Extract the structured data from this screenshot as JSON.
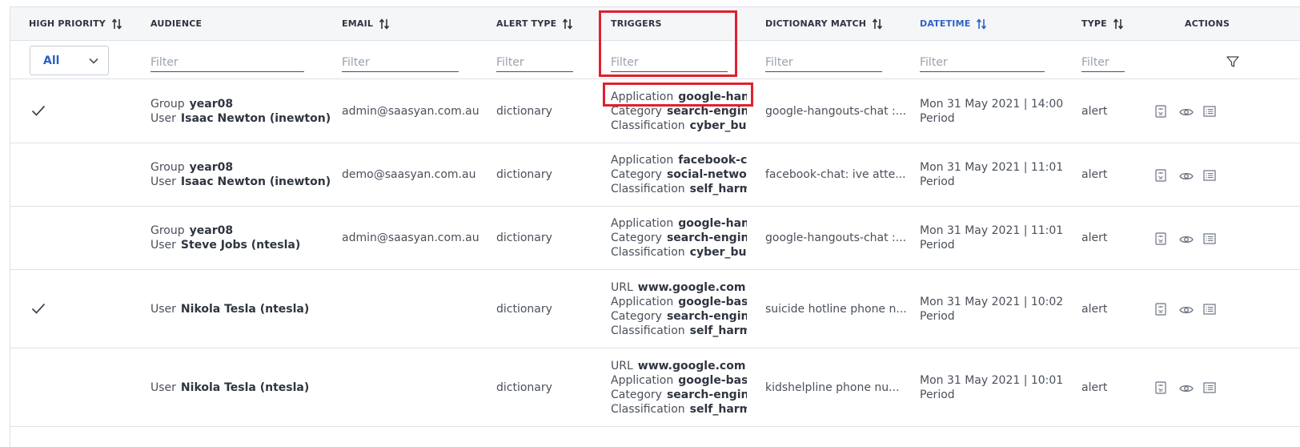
{
  "columns": {
    "high_priority": "HIGH PRIORITY",
    "audience": "AUDIENCE",
    "email": "EMAIL",
    "alert_type": "ALERT TYPE",
    "triggers": "TRIGGERS",
    "dictionary_match": "DICTIONARY MATCH",
    "datetime": "DATETIME",
    "type": "TYPE",
    "actions": "ACTIONS"
  },
  "filters": {
    "priority_select_value": "All",
    "placeholder": "Filter"
  },
  "colors": {
    "accent": "#2f64c8",
    "highlight": "#e0202e",
    "border": "#dde1e6"
  },
  "rows": [
    {
      "high_priority": true,
      "audience": [
        {
          "key": "Group",
          "value": "year08"
        },
        {
          "key": "User",
          "value": "Isaac Newton (inewton)"
        }
      ],
      "email": "admin@saasyan.com.au",
      "alert_type": "dictionary",
      "triggers": [
        {
          "key": "Application",
          "value": "google-hangouts-chat"
        },
        {
          "key": "Category",
          "value": "search-engines"
        },
        {
          "key": "Classification",
          "value": "cyber_bullying"
        }
      ],
      "dictionary_match": "google-hangouts-chat :...",
      "datetime": "Mon 31 May 2021 | 14:00",
      "period": "Period",
      "type": "alert"
    },
    {
      "high_priority": false,
      "audience": [
        {
          "key": "Group",
          "value": "year08"
        },
        {
          "key": "User",
          "value": "Isaac Newton (inewton)"
        }
      ],
      "email": "demo@saasyan.com.au",
      "alert_type": "dictionary",
      "triggers": [
        {
          "key": "Application",
          "value": "facebook-chat"
        },
        {
          "key": "Category",
          "value": "social-networking"
        },
        {
          "key": "Classification",
          "value": "self_harm"
        }
      ],
      "dictionary_match": "facebook-chat: ive atte...",
      "datetime": "Mon 31 May 2021 | 11:01",
      "period": "Period",
      "type": "alert"
    },
    {
      "high_priority": false,
      "audience": [
        {
          "key": "Group",
          "value": "year08"
        },
        {
          "key": "User",
          "value": "Steve Jobs (ntesla)"
        }
      ],
      "email": "admin@saasyan.com.au",
      "alert_type": "dictionary",
      "triggers": [
        {
          "key": "Application",
          "value": "google-hangouts-chat"
        },
        {
          "key": "Category",
          "value": "search-engines"
        },
        {
          "key": "Classification",
          "value": "cyber_bullying"
        }
      ],
      "dictionary_match": "google-hangouts-chat :...",
      "datetime": "Mon 31 May 2021 | 11:01",
      "period": "Period",
      "type": "alert"
    },
    {
      "high_priority": true,
      "audience": [
        {
          "key": "User",
          "value": "Nikola Tesla (ntesla)"
        }
      ],
      "email": "",
      "alert_type": "dictionary",
      "triggers": [
        {
          "key": "URL",
          "value": "www.google.com"
        },
        {
          "key": "Application",
          "value": "google-base"
        },
        {
          "key": "Category",
          "value": "search-engines"
        },
        {
          "key": "Classification",
          "value": "self_harm"
        }
      ],
      "dictionary_match": "suicide hotline phone n...",
      "datetime": "Mon 31 May 2021 | 10:02",
      "period": "Period",
      "type": "alert"
    },
    {
      "high_priority": false,
      "audience": [
        {
          "key": "User",
          "value": "Nikola Tesla (ntesla)"
        }
      ],
      "email": "",
      "alert_type": "dictionary",
      "triggers": [
        {
          "key": "URL",
          "value": "www.google.com"
        },
        {
          "key": "Application",
          "value": "google-base"
        },
        {
          "key": "Category",
          "value": "search-engines"
        },
        {
          "key": "Classification",
          "value": "self_harm"
        }
      ],
      "dictionary_match": "kidshelpline phone nu...",
      "datetime": "Mon 31 May 2021 | 10:01",
      "period": "Period",
      "type": "alert"
    }
  ]
}
